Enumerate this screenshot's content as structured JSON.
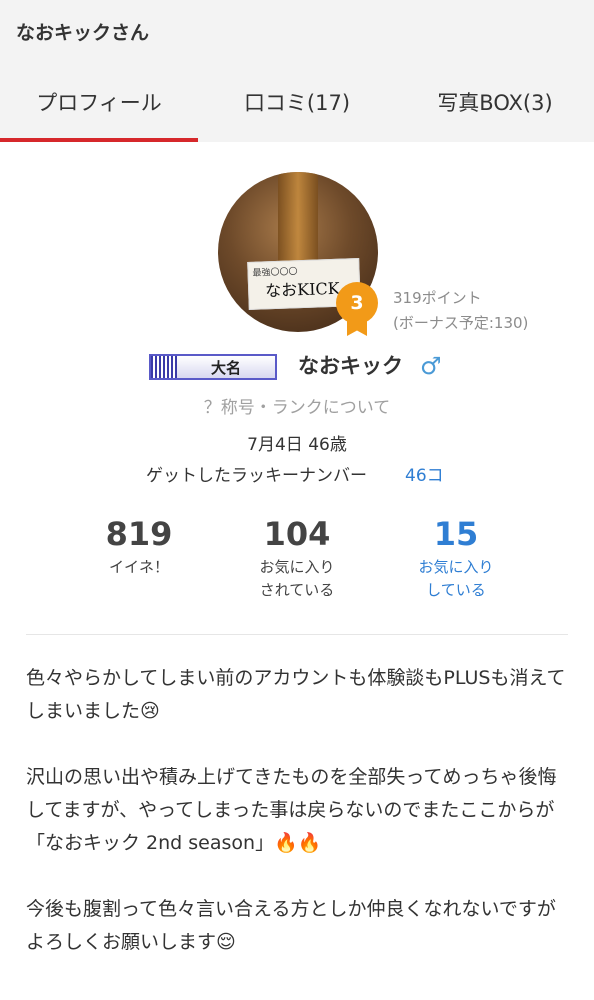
{
  "header": {
    "title": "なおキックさん"
  },
  "tabs": [
    {
      "label": "プロフィール",
      "active": true
    },
    {
      "label": "口コミ(17)",
      "active": false
    },
    {
      "label": "写真BOX(3)",
      "active": false
    }
  ],
  "colors": {
    "accent": "#d6282b",
    "link": "#2f7ed3",
    "badge": "#f29a18"
  },
  "profile": {
    "rank": "3",
    "points": "319ポイント",
    "bonus": "(ボーナス予定:130)",
    "title_badge": "大名",
    "username": "なおキック",
    "gender_icon": "♂",
    "rank_link": "？称号・ランクについて",
    "birth": "7月4日 46歳",
    "lucky_label": "ゲットしたラッキーナンバー",
    "lucky_count": "46コ"
  },
  "stats": [
    {
      "value": "819",
      "label1": "イイネ！",
      "label2": ""
    },
    {
      "value": "104",
      "label1": "お気に入り",
      "label2": "されている"
    },
    {
      "value": "15",
      "label1": "お気に入り",
      "label2": "している"
    }
  ],
  "intro": [
    "色々やらかしてしまい前のアカウントも体験談もPLUSも消えてしまいました😢",
    "沢山の思い出や積み上げてきたものを全部失ってめっちゃ後悔してますが、やってしまった事は戻らないのでまたここからが「なおキック 2nd season」🔥🔥",
    "今後も腹割って色々言い合える方としか仲良くなれないですがよろしくお願いします😌"
  ]
}
